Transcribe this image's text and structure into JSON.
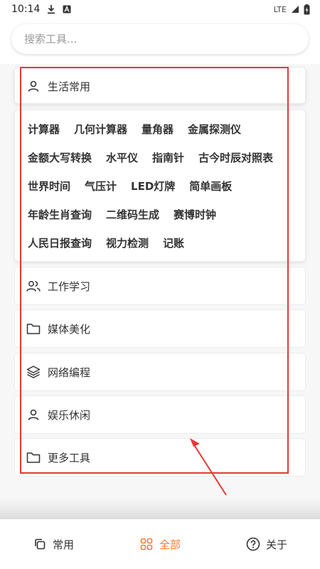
{
  "status_bar": {
    "time": "10:14",
    "network": "LTE"
  },
  "search": {
    "placeholder": "搜索工具...",
    "value": ""
  },
  "categories": [
    {
      "label": "生活常用",
      "icon": "person-icon",
      "expanded": true,
      "tools": [
        [
          "计算器",
          "几何计算器",
          "量角器",
          "金属探测仪"
        ],
        [
          "金额大写转换",
          "水平仪",
          "指南针",
          "古今时辰对照表"
        ],
        [
          "世界时间",
          "气压计",
          "LED灯牌",
          "简单画板"
        ],
        [
          "年龄生肖查询",
          "二维码生成",
          "赛博时钟"
        ],
        [
          "人民日报查询",
          "视力检测",
          "记账"
        ]
      ]
    },
    {
      "label": "工作学习",
      "icon": "people-icon",
      "expanded": false
    },
    {
      "label": "媒体美化",
      "icon": "folder-icon",
      "expanded": false
    },
    {
      "label": "网络编程",
      "icon": "layers-icon",
      "expanded": false
    },
    {
      "label": "娱乐休闲",
      "icon": "person-icon",
      "expanded": false
    },
    {
      "label": "更多工具",
      "icon": "folder-icon",
      "expanded": false
    }
  ],
  "bottom_nav": [
    {
      "label": "常用",
      "icon": "copy-icon",
      "active": false
    },
    {
      "label": "全部",
      "icon": "grid-icon",
      "active": true
    },
    {
      "label": "关于",
      "icon": "help-icon",
      "active": false
    }
  ],
  "colors": {
    "accent": "#ff7a2e",
    "annotation": "#e53935"
  }
}
